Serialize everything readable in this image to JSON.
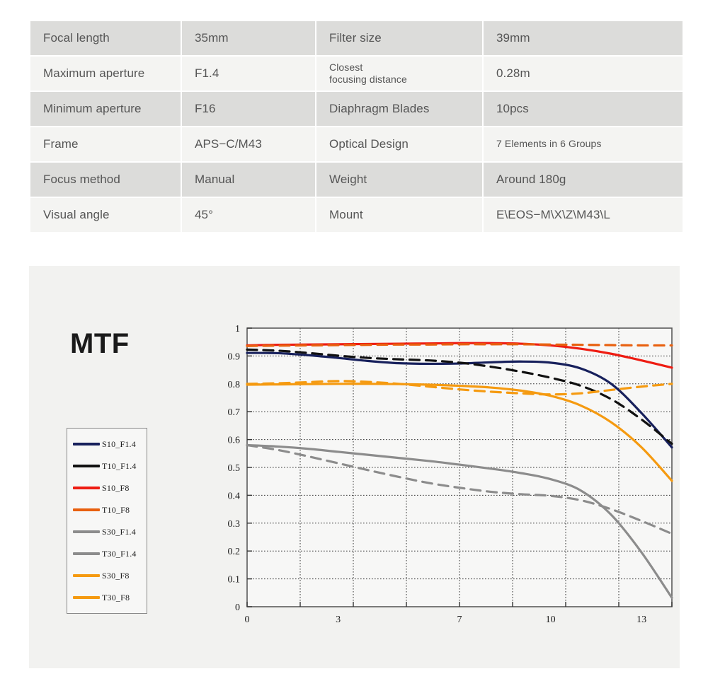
{
  "spec_table": {
    "rows": [
      {
        "shade": "shade",
        "label_a": "Focal length",
        "value_a": "35mm",
        "label_b": "Filter size",
        "value_b": "39mm",
        "label_b_small": false,
        "value_b_small": false
      },
      {
        "shade": "light",
        "label_a": "Maximum aperture",
        "value_a": "F1.4",
        "label_b": "Closest\nfocusing distance",
        "value_b": "0.28m",
        "label_b_small": true,
        "value_b_small": false
      },
      {
        "shade": "shade",
        "label_a": "Minimum aperture",
        "value_a": "F16",
        "label_b": "Diaphragm Blades",
        "value_b": "10pcs",
        "label_b_small": false,
        "value_b_small": false
      },
      {
        "shade": "light",
        "label_a": "Frame",
        "value_a": "APS−C/M43",
        "label_b": "Optical Design",
        "value_b": "7 Elements in 6 Groups",
        "label_b_small": false,
        "value_b_small": true
      },
      {
        "shade": "shade",
        "label_a": "Focus method",
        "value_a": "Manual",
        "label_b": "Weight",
        "value_b": "Around 180g",
        "label_b_small": false,
        "value_b_small": false
      },
      {
        "shade": "light",
        "label_a": "Visual angle",
        "value_a": "45°",
        "label_b": "Mount",
        "value_b": "E\\EOS−M\\X\\Z\\M43\\L",
        "label_b_small": false,
        "value_b_small": false
      }
    ]
  },
  "mtf": {
    "title": "MTF"
  },
  "chart_data": {
    "type": "line",
    "title": "MTF",
    "xlabel": "",
    "ylabel": "",
    "xlim": [
      0,
      14
    ],
    "ylim": [
      0,
      1
    ],
    "grid": true,
    "legend_position": "left-outside",
    "x_tick_labels": [
      "0",
      "3",
      "7",
      "10",
      "13"
    ],
    "x_tick_values": [
      0,
      3,
      7,
      10,
      13
    ],
    "x_gridline_values": [
      0,
      1.75,
      3.5,
      5.25,
      7,
      8.75,
      10.5,
      12.25,
      14
    ],
    "y_tick_labels": [
      "0",
      "0.1",
      "0.2",
      "0.3",
      "0.4",
      "0.5",
      "0.6",
      "0.7",
      "0.8",
      "0.9",
      "1"
    ],
    "y_tick_values": [
      0,
      0.1,
      0.2,
      0.3,
      0.4,
      0.5,
      0.6,
      0.7,
      0.8,
      0.9,
      1
    ],
    "x": [
      0,
      1,
      2,
      3,
      4,
      5,
      6,
      7,
      8,
      9,
      10,
      11,
      12,
      13,
      14
    ],
    "series": [
      {
        "name": "S10_F1.4",
        "color": "#17205c",
        "style": "solid",
        "values": [
          0.911,
          0.91,
          0.903,
          0.893,
          0.882,
          0.874,
          0.872,
          0.873,
          0.877,
          0.88,
          0.876,
          0.855,
          0.8,
          0.695,
          0.572
        ]
      },
      {
        "name": "T10_F1.4",
        "color": "#111111",
        "style": "dashed",
        "values": [
          0.923,
          0.919,
          0.911,
          0.901,
          0.893,
          0.888,
          0.884,
          0.876,
          0.862,
          0.844,
          0.822,
          0.793,
          0.745,
          0.672,
          0.585
        ]
      },
      {
        "name": "S10_F8",
        "color": "#ee1c12",
        "style": "solid",
        "values": [
          0.938,
          0.94,
          0.941,
          0.942,
          0.943,
          0.944,
          0.945,
          0.946,
          0.946,
          0.944,
          0.938,
          0.926,
          0.908,
          0.884,
          0.858
        ]
      },
      {
        "name": "T10_F8",
        "color": "#e8600f",
        "style": "dashed",
        "values": [
          0.936,
          0.937,
          0.938,
          0.939,
          0.94,
          0.941,
          0.941,
          0.942,
          0.942,
          0.942,
          0.941,
          0.94,
          0.939,
          0.938,
          0.938
        ]
      },
      {
        "name": "S30_F1.4",
        "color": "#8c8c8c",
        "style": "solid",
        "values": [
          0.58,
          0.575,
          0.567,
          0.556,
          0.545,
          0.534,
          0.523,
          0.51,
          0.496,
          0.48,
          0.458,
          0.417,
          0.33,
          0.195,
          0.032
        ]
      },
      {
        "name": "T30_F1.4",
        "color": "#8c8c8c",
        "style": "dashed",
        "values": [
          0.58,
          0.563,
          0.54,
          0.515,
          0.49,
          0.466,
          0.444,
          0.427,
          0.413,
          0.404,
          0.398,
          0.382,
          0.35,
          0.308,
          0.262
        ]
      },
      {
        "name": "S30_F8",
        "color": "#f59a10",
        "style": "solid",
        "values": [
          0.797,
          0.798,
          0.799,
          0.8,
          0.8,
          0.799,
          0.797,
          0.793,
          0.787,
          0.776,
          0.757,
          0.722,
          0.662,
          0.572,
          0.452
        ]
      },
      {
        "name": "T30_F8",
        "color": "#f59a10",
        "style": "dashed",
        "values": [
          0.8,
          0.802,
          0.806,
          0.81,
          0.807,
          0.8,
          0.79,
          0.78,
          0.772,
          0.766,
          0.762,
          0.766,
          0.778,
          0.79,
          0.8
        ]
      }
    ]
  }
}
